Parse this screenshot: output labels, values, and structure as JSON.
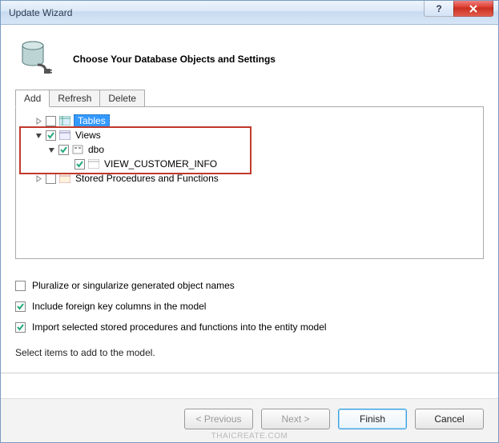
{
  "window": {
    "title": "Update Wizard"
  },
  "header": {
    "heading": "Choose Your Database Objects and Settings"
  },
  "tabs": {
    "items": [
      {
        "label": "Add",
        "active": true
      },
      {
        "label": "Refresh",
        "active": false
      },
      {
        "label": "Delete",
        "active": false
      }
    ]
  },
  "tree": {
    "tables_label": "Tables",
    "views_label": "Views",
    "dbo_label": "dbo",
    "view_item_label": "VIEW_CUSTOMER_INFO",
    "sprocs_label": "Stored Procedures and Functions"
  },
  "options": {
    "pluralize": {
      "label": "Pluralize or singularize generated object names",
      "checked": false
    },
    "include_fk": {
      "label": "Include foreign key columns in the model",
      "checked": true
    },
    "import_sprocs": {
      "label": "Import selected stored procedures and functions into the entity model",
      "checked": true
    }
  },
  "hint": "Select items to add to the model.",
  "buttons": {
    "previous": "< Previous",
    "next": "Next >",
    "finish": "Finish",
    "cancel": "Cancel"
  },
  "titlebar_icons": {
    "help": "?",
    "close": "close-icon"
  },
  "watermark": "THAICREATE.COM"
}
